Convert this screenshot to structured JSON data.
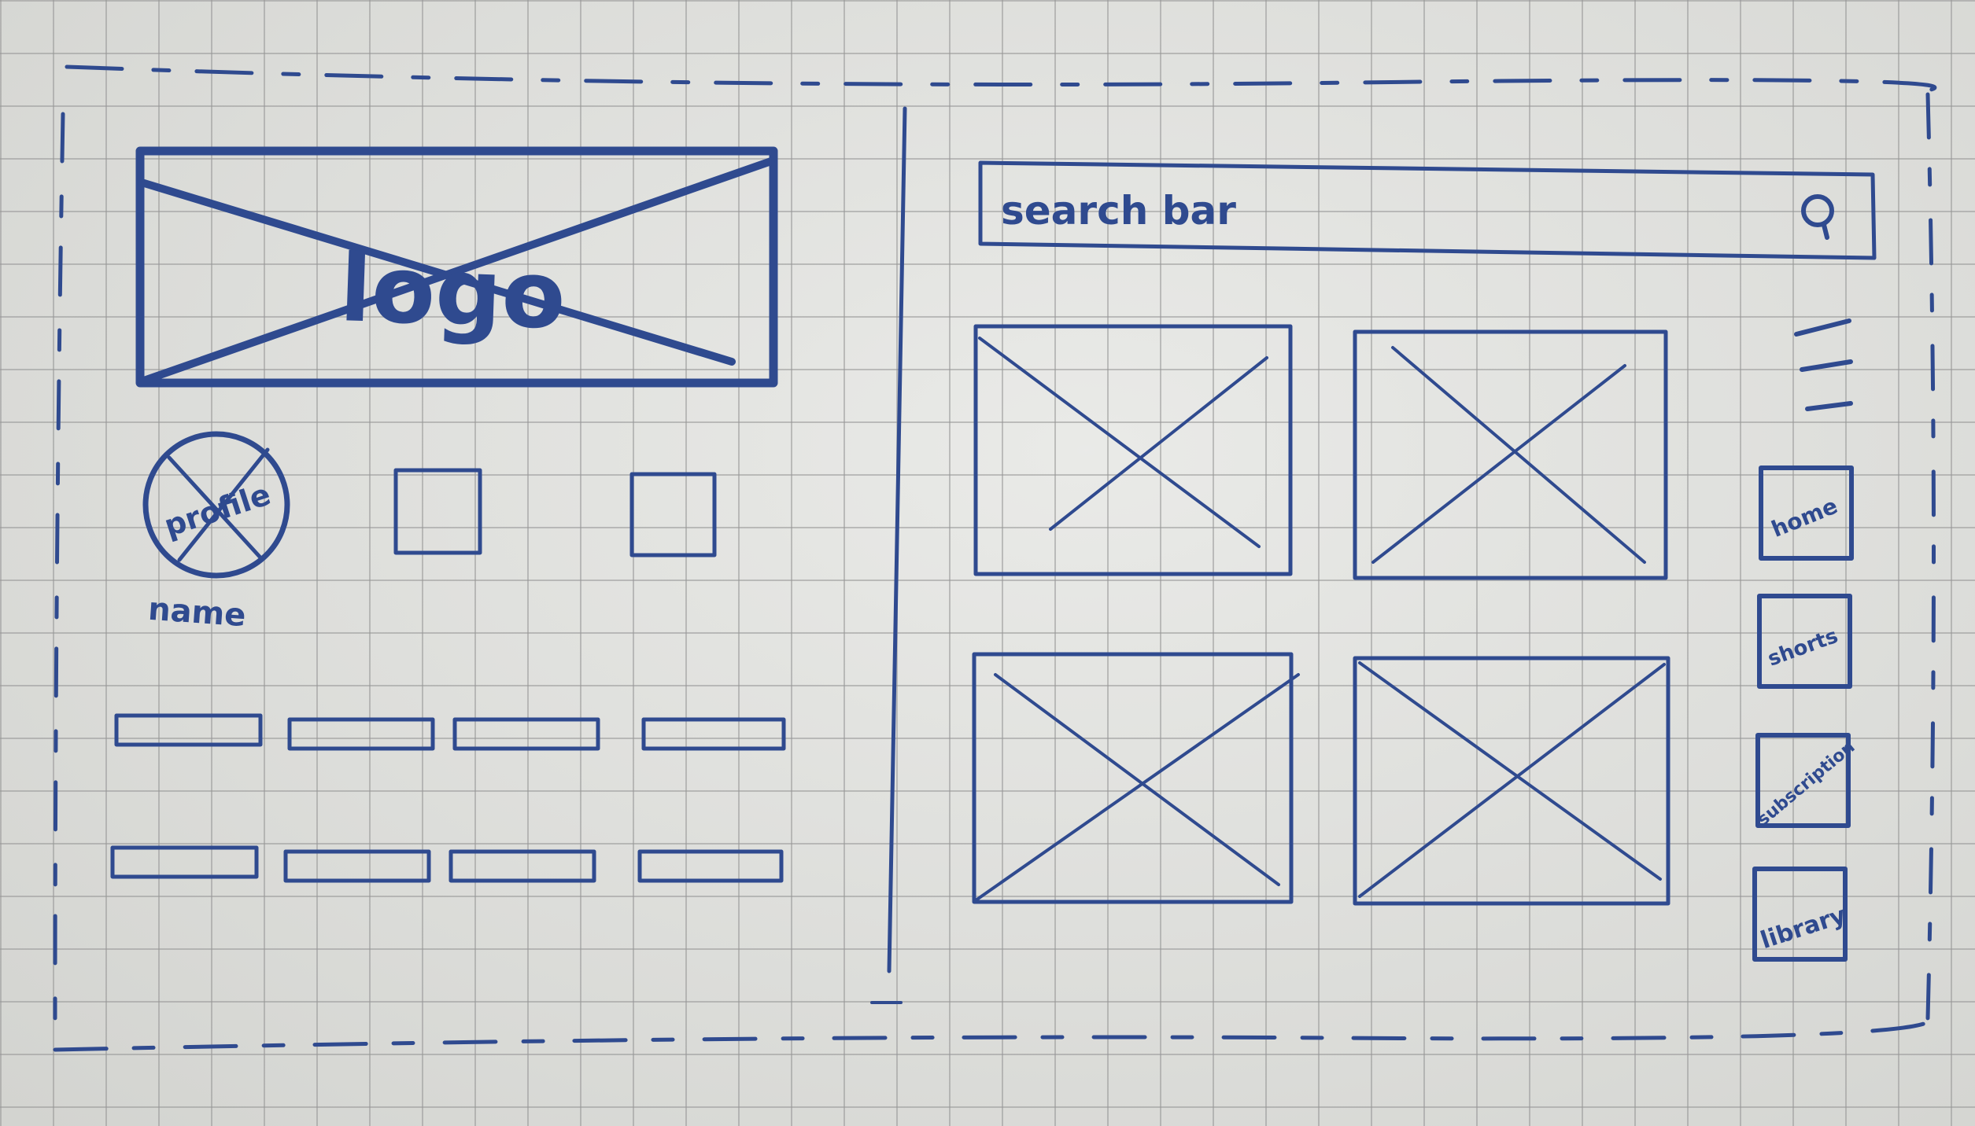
{
  "ink_color": "#2f4a8f",
  "paper_color": "#dedfdb",
  "logo": {
    "label": "logo"
  },
  "profile": {
    "avatar_label": "profile",
    "name_label": "name"
  },
  "search": {
    "label": "search bar",
    "icon": "search-icon"
  },
  "menu": {
    "icon": "hamburger-menu-icon"
  },
  "nav": {
    "items": [
      {
        "label": "home"
      },
      {
        "label": "shorts"
      },
      {
        "label": "subscription"
      },
      {
        "label": "library"
      }
    ]
  }
}
